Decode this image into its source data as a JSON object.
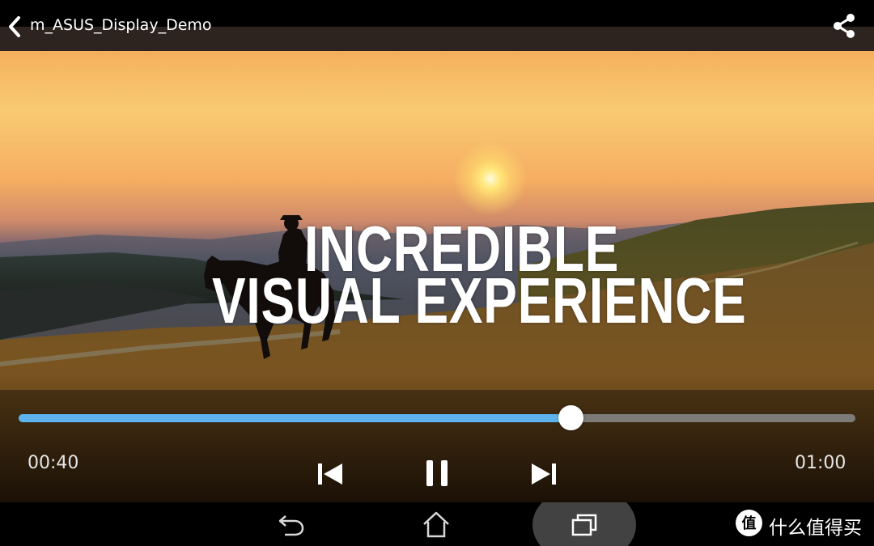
{
  "app_bar": {
    "title": "m_ASUS_Display_Demo",
    "back_icon": "chevron-left-icon",
    "share_icon": "share-icon"
  },
  "video": {
    "caption_line1": "INCREDIBLE",
    "caption_line2": "VISUAL EXPERIENCE"
  },
  "player": {
    "current_time": "00:40",
    "total_time": "01:00",
    "progress_fraction": 0.66,
    "accent_color": "#5cb3ee",
    "buttons": [
      "skip-previous-icon",
      "pause-icon",
      "skip-next-icon"
    ]
  },
  "navigation_bar": {
    "buttons": [
      "back-icon",
      "home-icon",
      "recent-apps-icon"
    ]
  },
  "watermark": {
    "glyph": "值",
    "text": "什么值得买"
  }
}
